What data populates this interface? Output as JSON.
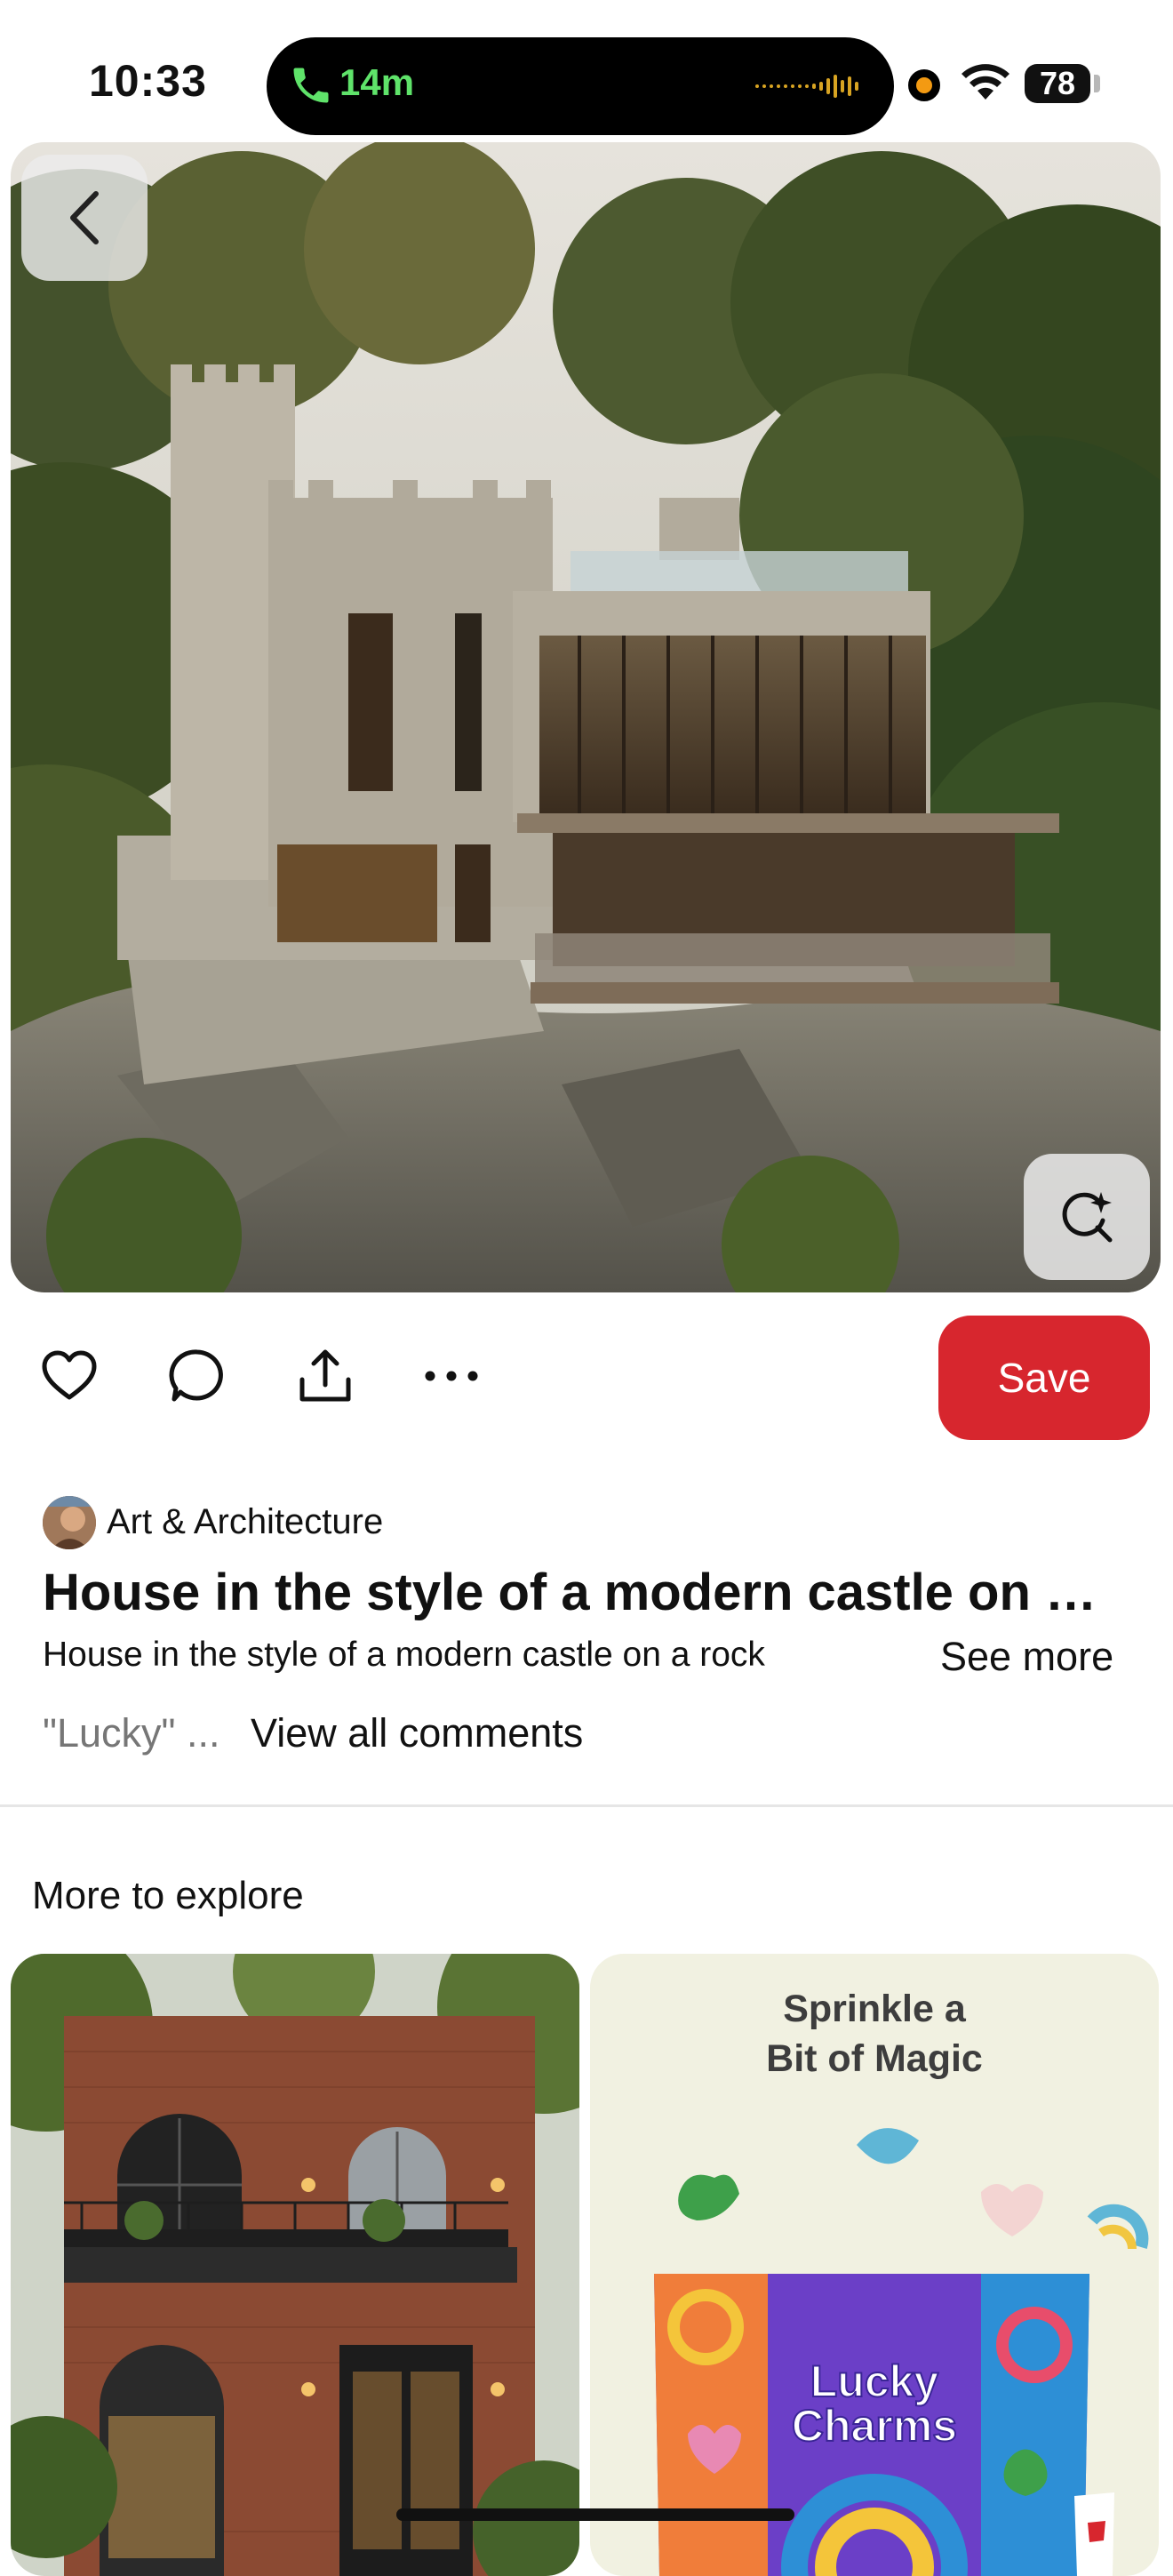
{
  "status_bar": {
    "time": "10:33",
    "call_duration": "14m",
    "battery": "78"
  },
  "pin": {
    "board_name": "Art & Architecture",
    "title": "House in the style of a modern castle on a rock",
    "description": "House in the style of a modern castle on a rock",
    "see_more_label": "See more",
    "comment_preview": "\"Lucky\" ...",
    "view_comments_label": "View all comments"
  },
  "actions": {
    "like_icon": "heart-icon",
    "comment_icon": "comment-bubble-icon",
    "share_icon": "share-icon",
    "more_icon": "more-dots-icon",
    "save_label": "Save"
  },
  "explore": {
    "title": "More to explore",
    "ad": {
      "headline_line1": "Sprinkle a",
      "headline_line2": "Bit of Magic",
      "brand": "Lucky Charms"
    }
  },
  "colors": {
    "save_button": "#d7262e",
    "call_green": "#5fe36a",
    "recording_dot": "#f39a12"
  }
}
